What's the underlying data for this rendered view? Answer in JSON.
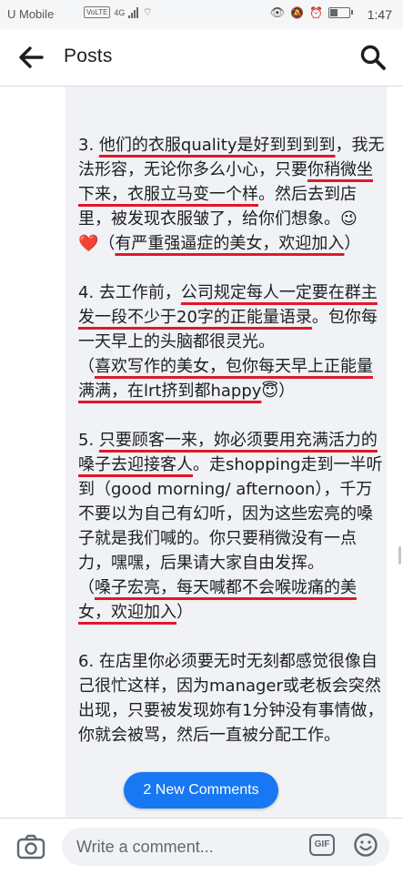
{
  "status_bar": {
    "carrier": "U Mobile",
    "volte": "VoLTE",
    "network": "4G",
    "time": "1:47"
  },
  "header": {
    "title": "Posts",
    "back_icon": "arrow-left-icon",
    "search_icon": "search-icon"
  },
  "post": {
    "paragraph3": {
      "seg1": "3. ",
      "seg2": "他们的衣服quality是好到到到到",
      "seg3": "，我无法形容，无论你多么小心，只要",
      "seg4": "你稍微坐下来，衣服立马变一个样",
      "seg5": "。然后去到店里，被发现衣服皱了，给你们想象。",
      "emoji": "😉",
      "heart": "❤️",
      "seg6": "（",
      "seg7": "有严重强逼症的美女，欢迎加入",
      "seg8": "）"
    },
    "paragraph4": {
      "seg1": "4. 去工作前，",
      "seg2": "公司规定每人一定要在群主发一段不少于20字的正能量语录",
      "seg3": "。包你每一天早上的头脑都很灵光。",
      "seg4": "（",
      "seg5": "喜欢写作的美女，包你每天早上正能量满满，在lrt挤到都happy",
      "emoji": "😇",
      "seg6": "）"
    },
    "paragraph5": {
      "seg1": "5. ",
      "seg2": "只要顾客一来，妳必须要用充满活力的嗓子去迎接客人",
      "seg3": "。走shopping走到一半听到（good morning/ afternoon），千万不要以为自己有幻听，因为这些宏亮的嗓子就是我们喊的。你只要稍微没有一点力，嘿嘿，后果请大家自由发挥。",
      "seg4": "（",
      "seg5": "嗓子宏亮，每天喊都不会喉咙痛的美女，欢迎加入",
      "seg6": "）"
    },
    "paragraph6": {
      "text": "6. 在店里你必须要无时无刻都感觉很像自己很忙这样，因为manager或老板会突然出现，只要被发现妳有1分钟没有事情做，你就会被骂，然后一直被分配工作。"
    }
  },
  "new_comments": {
    "label": "2 New Comments"
  },
  "composer": {
    "placeholder": "Write a comment...",
    "gif_label": "GIF",
    "camera_icon": "camera-icon",
    "emoji_icon": "smiley-icon"
  },
  "colors": {
    "accent": "#1877f2",
    "underline": "#e0182c",
    "bubble": "#f0f2f5"
  }
}
